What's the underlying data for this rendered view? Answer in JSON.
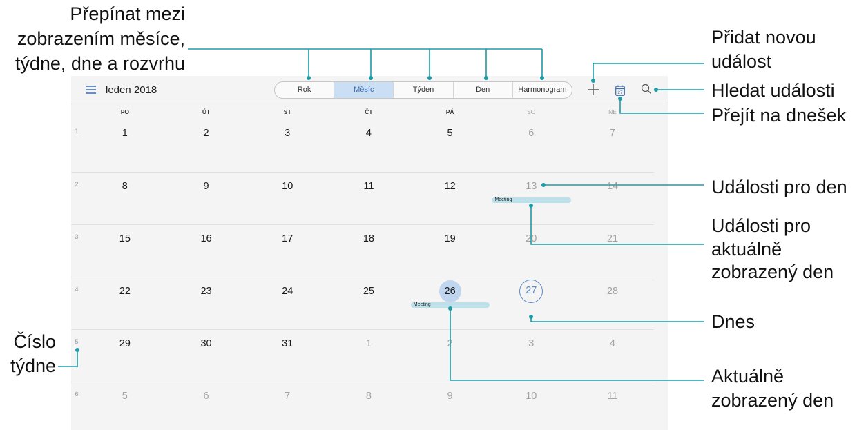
{
  "annotations": {
    "view_switch": [
      "Přepínat mezi",
      "zobrazením měsíce,",
      "týdne, dne a rozvrhu"
    ],
    "add_event": [
      "Přidat novou",
      "událost"
    ],
    "search_events": "Hledat události",
    "go_to_today": "Přejít na dnešek",
    "day_events": "Události pro den",
    "displayed_day_events": [
      "Události pro",
      "aktuálně",
      "zobrazený den"
    ],
    "today": "Dnes",
    "displayed_day": [
      "Aktuálně",
      "zobrazený den"
    ],
    "week_number": [
      "Číslo",
      "týdne"
    ]
  },
  "toolbar": {
    "month_title": "leden 2018",
    "views": [
      "Rok",
      "Měsíc",
      "Týden",
      "Den",
      "Harmonogram"
    ],
    "selected_view_index": 1,
    "today_icon_day": "27"
  },
  "icons": {
    "menu": "menu-icon",
    "add": "plus-icon",
    "today": "calendar-today-icon",
    "search": "search-icon"
  },
  "weekdays": [
    "PO",
    "ÚT",
    "ST",
    "ČT",
    "PÁ",
    "SO",
    "NE"
  ],
  "weeks": [
    {
      "number": "1",
      "days": [
        {
          "date": "1"
        },
        {
          "date": "2"
        },
        {
          "date": "3"
        },
        {
          "date": "4"
        },
        {
          "date": "5"
        },
        {
          "date": "6",
          "muted": true
        },
        {
          "date": "7",
          "muted": true
        }
      ]
    },
    {
      "number": "2",
      "days": [
        {
          "date": "8"
        },
        {
          "date": "9"
        },
        {
          "date": "10"
        },
        {
          "date": "11"
        },
        {
          "date": "12"
        },
        {
          "date": "13",
          "muted": true,
          "event": "Meeting"
        },
        {
          "date": "14",
          "muted": true
        }
      ]
    },
    {
      "number": "3",
      "days": [
        {
          "date": "15"
        },
        {
          "date": "16"
        },
        {
          "date": "17"
        },
        {
          "date": "18"
        },
        {
          "date": "19"
        },
        {
          "date": "20",
          "muted": true
        },
        {
          "date": "21",
          "muted": true
        }
      ]
    },
    {
      "number": "4",
      "days": [
        {
          "date": "22"
        },
        {
          "date": "23"
        },
        {
          "date": "24"
        },
        {
          "date": "25"
        },
        {
          "date": "26",
          "selected": true,
          "event": "Meeting"
        },
        {
          "date": "27",
          "today": true
        },
        {
          "date": "28",
          "muted": true
        }
      ]
    },
    {
      "number": "5",
      "days": [
        {
          "date": "29"
        },
        {
          "date": "30"
        },
        {
          "date": "31"
        },
        {
          "date": "1",
          "muted": true
        },
        {
          "date": "2",
          "muted": true
        },
        {
          "date": "3",
          "muted": true
        },
        {
          "date": "4",
          "muted": true
        }
      ]
    },
    {
      "number": "6",
      "days": [
        {
          "date": "5",
          "muted": true
        },
        {
          "date": "6",
          "muted": true
        },
        {
          "date": "7",
          "muted": true
        },
        {
          "date": "8",
          "muted": true
        },
        {
          "date": "9",
          "muted": true
        },
        {
          "date": "10",
          "muted": true
        },
        {
          "date": "11",
          "muted": true
        }
      ]
    }
  ],
  "colors": {
    "annotation_line": "#1d9ba6",
    "accent_blue": "#3b6db4",
    "selected_day_bg": "#c0d6ef",
    "today_ring": "#5b8bc8",
    "event_bar": "#bde0ea",
    "panel_bg": "#f4f4f4",
    "segment_selected_bg": "#cadef4"
  }
}
